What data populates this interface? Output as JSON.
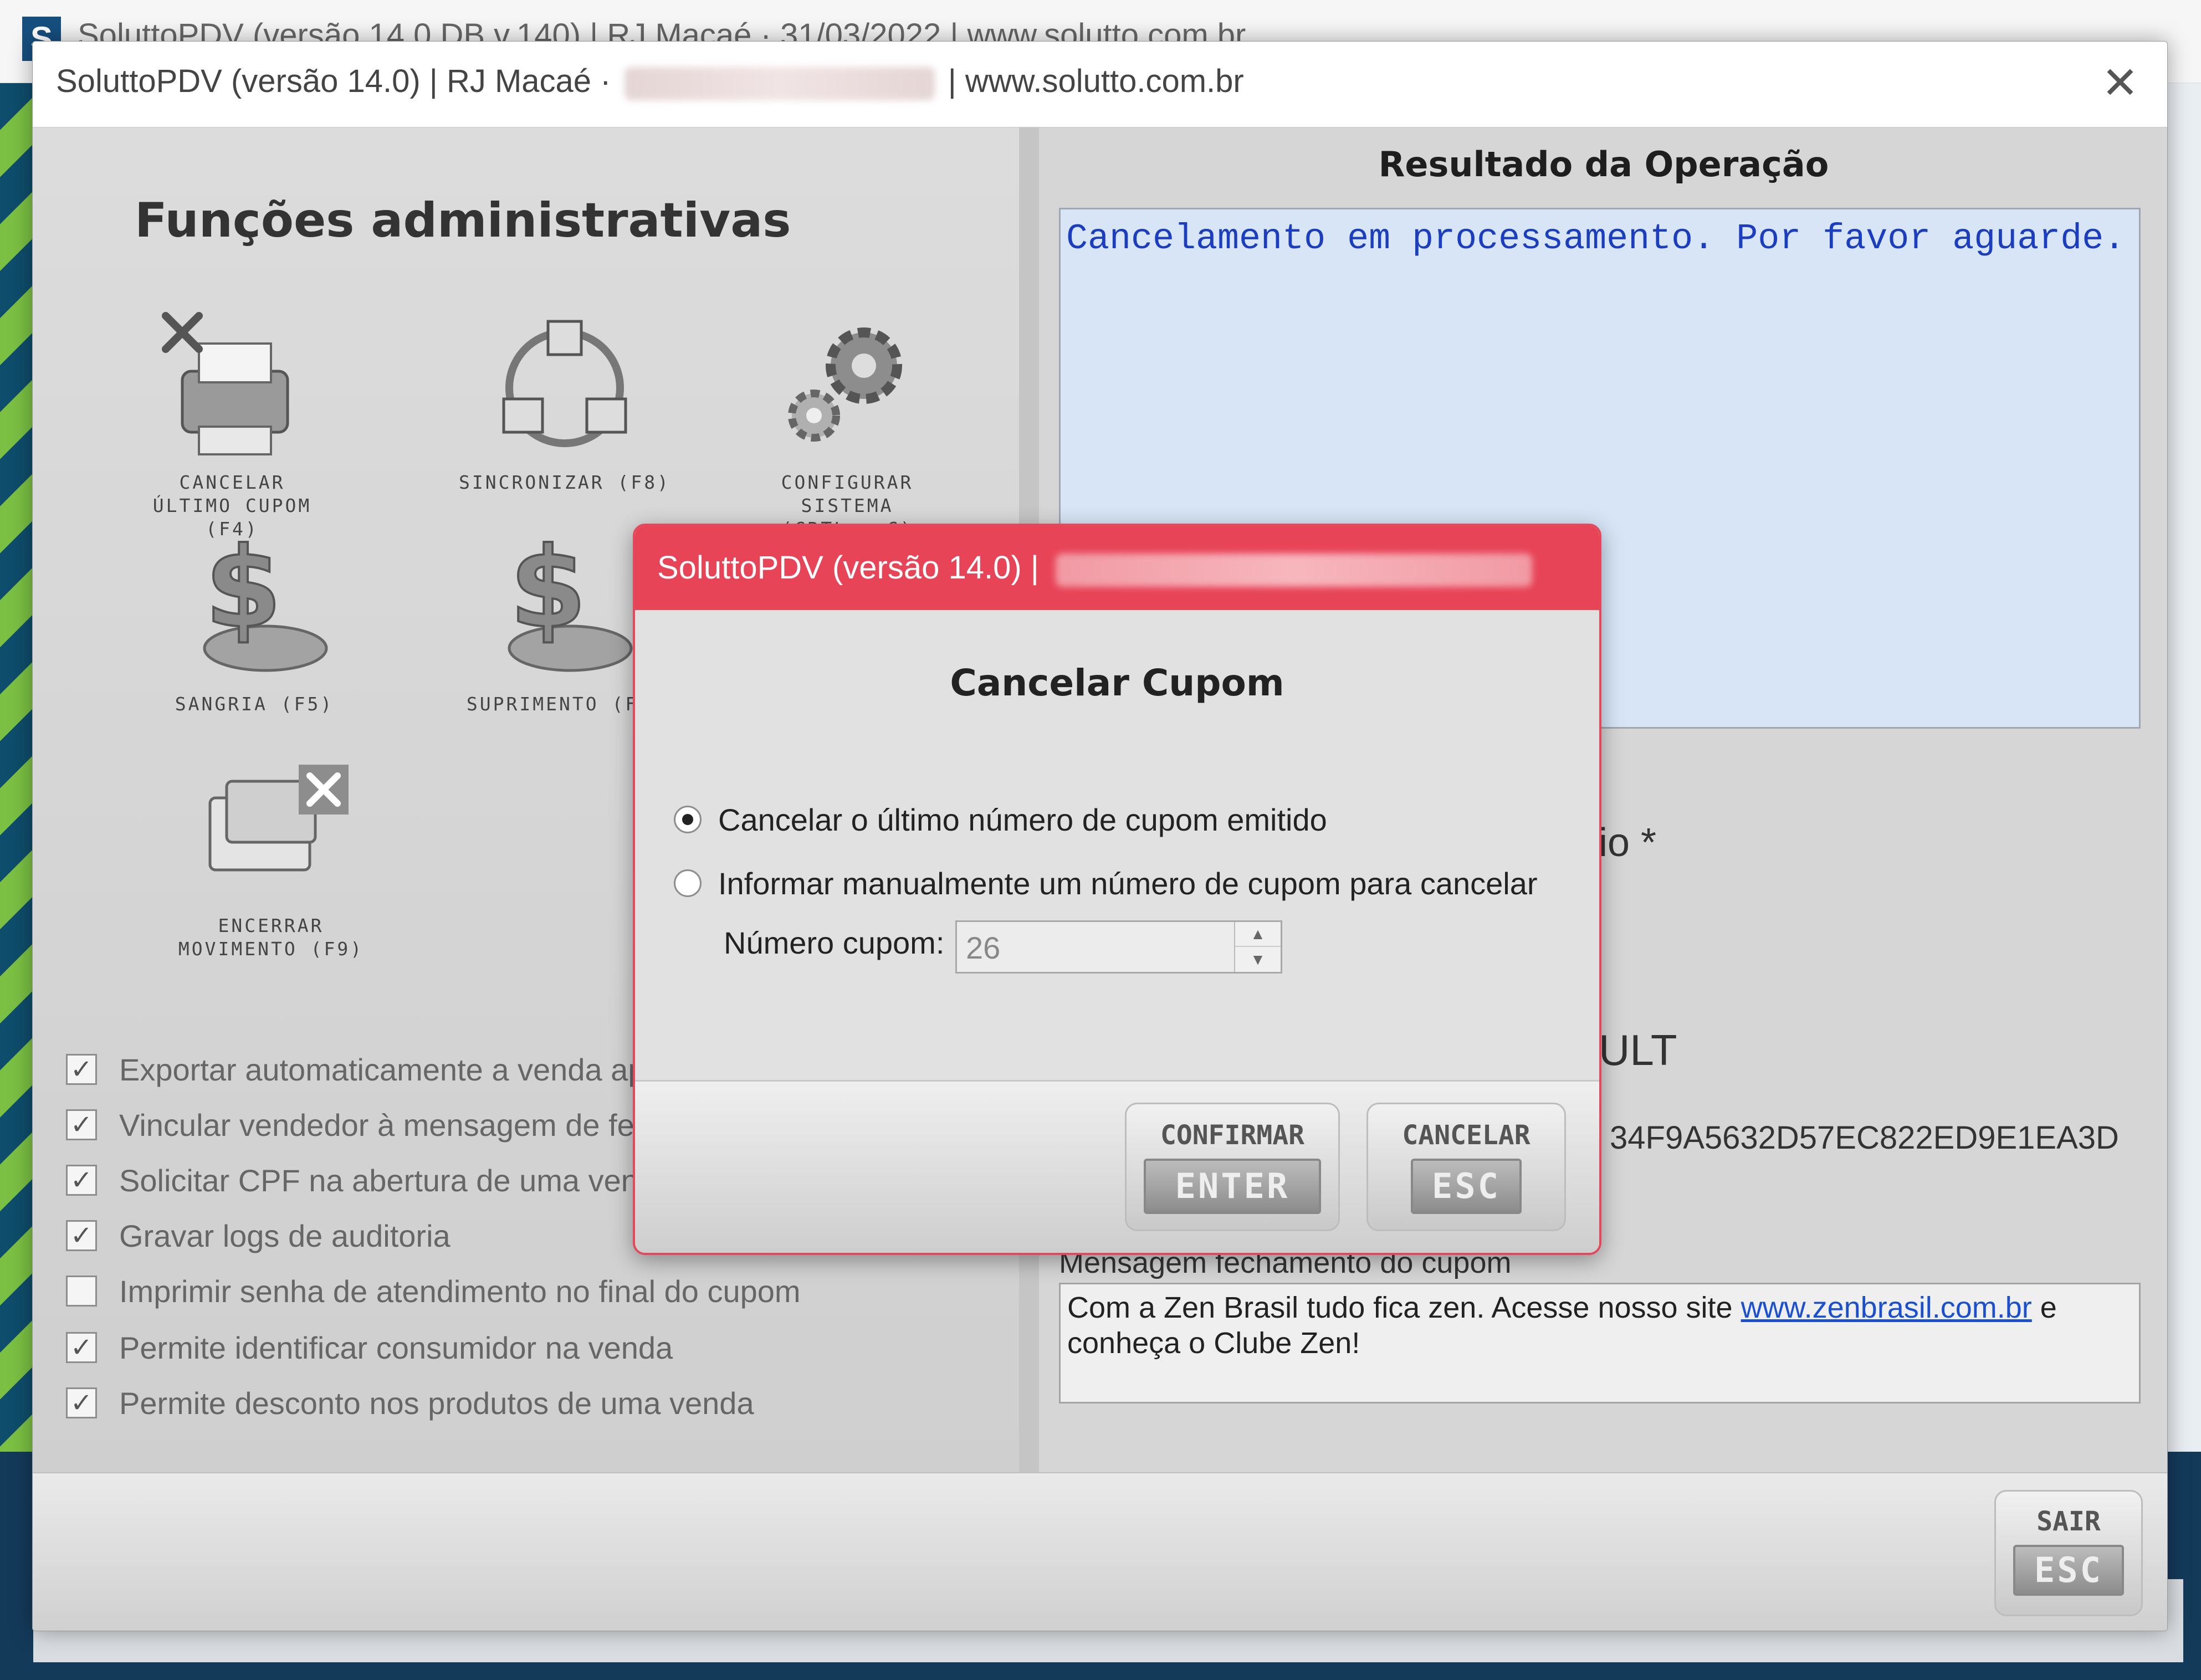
{
  "background": {
    "logo": "S",
    "title": "SoluttoPDV (versão 14.0 DB v.140) | RJ Macaé · 31/03/2022 | www.solutto.com.br"
  },
  "window": {
    "title_prefix": "SoluttoPDV (versão 14.0) | RJ Macaé ·",
    "title_suffix": "| www.solutto.com.br",
    "close": "✕"
  },
  "left": {
    "title": "Funções administrativas",
    "functions": [
      {
        "label": "CANCELAR\nÚLTIMO CUPOM (F4)",
        "icon": "printer-cancel-icon"
      },
      {
        "label": "SINCRONIZAR (F8)",
        "icon": "network-sync-icon"
      },
      {
        "label": "CONFIGURAR\nSISTEMA\n(CRTL + C)",
        "icon": "gears-icon"
      },
      {
        "label": "SANGRIA (F5)",
        "icon": "money-withdraw-icon"
      },
      {
        "label": "SUPRIMENTO (F6",
        "icon": "money-supply-icon"
      },
      {
        "label": "ENCERRAR\nMOVIMENTO (F9)",
        "icon": "cards-close-icon"
      }
    ],
    "options": [
      {
        "label": "Exportar automaticamente a venda ap",
        "checked": true
      },
      {
        "label": "Vincular vendedor à mensagem de fe",
        "checked": true
      },
      {
        "label": "Solicitar CPF na abertura de uma ven",
        "checked": true
      },
      {
        "label": "Gravar logs de auditoria",
        "checked": true
      },
      {
        "label": "Imprimir senha de atendimento no final do cupom",
        "checked": false
      },
      {
        "label": "Permite identificar consumidor na venda",
        "checked": true
      },
      {
        "label": "Permite desconto nos produtos de uma venda",
        "checked": true
      }
    ]
  },
  "right": {
    "result_title": "Resultado da Operação",
    "result_text": "Cancelamento em processamento. Por favor aguarde.",
    "partial_1": "io *",
    "partial_2": "ULT",
    "partial_3": "34F9A5632D57EC822ED9E1EA3D",
    "message_label": "Mensagem fechamento do cupom",
    "message_text_1": "Com a Zen Brasil tudo fica zen. Acesse nosso    site ",
    "message_link": "www.zenbrasil.com.br",
    "message_text_2": " e conheça o Clube Zen!"
  },
  "bottom": {
    "exit_top": "SAIR",
    "exit_key": "ESC"
  },
  "dialog": {
    "title": "SoluttoPDV (versão 14.0) |",
    "heading": "Cancelar Cupom",
    "option_last": "Cancelar o último número de cupom emitido",
    "option_manual": "Informar manualmente um número de cupom para cancelar",
    "selected_option": "last",
    "number_label": "Número cupom:",
    "number_value": "26",
    "confirm_top": "CONFIRMAR",
    "confirm_key": "ENTER",
    "cancel_top": "CANCELAR",
    "cancel_key": "ESC",
    "accent_color": "#e84458"
  }
}
